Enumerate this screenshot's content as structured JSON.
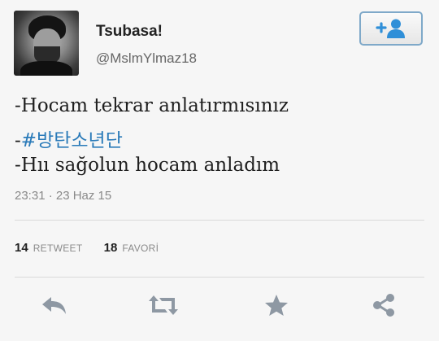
{
  "profile": {
    "display_name": "Tsubasa!",
    "handle": "@MslmYlmaz18"
  },
  "tweet": {
    "line1": "-Hocam tekrar anlatırmısınız",
    "line2_prefix": "-",
    "line2_hashtag": "#방탄소년단",
    "line3": "-Hıı sağolun hocam anladım",
    "timestamp": "23:31 · 23 Haz 15"
  },
  "stats": {
    "retweet_count": "14",
    "retweet_label": "RETWEET",
    "favorite_count": "18",
    "favorite_label": "FAVORİ"
  },
  "icons": {
    "follow": "follow-user-icon",
    "reply": "reply-icon",
    "retweet": "retweet-icon",
    "favorite": "star-icon",
    "share": "share-icon"
  },
  "colors": {
    "hashtag": "#2b7bb9",
    "follow_icon": "#2f8fd8",
    "action_icon": "#8e98a3"
  }
}
